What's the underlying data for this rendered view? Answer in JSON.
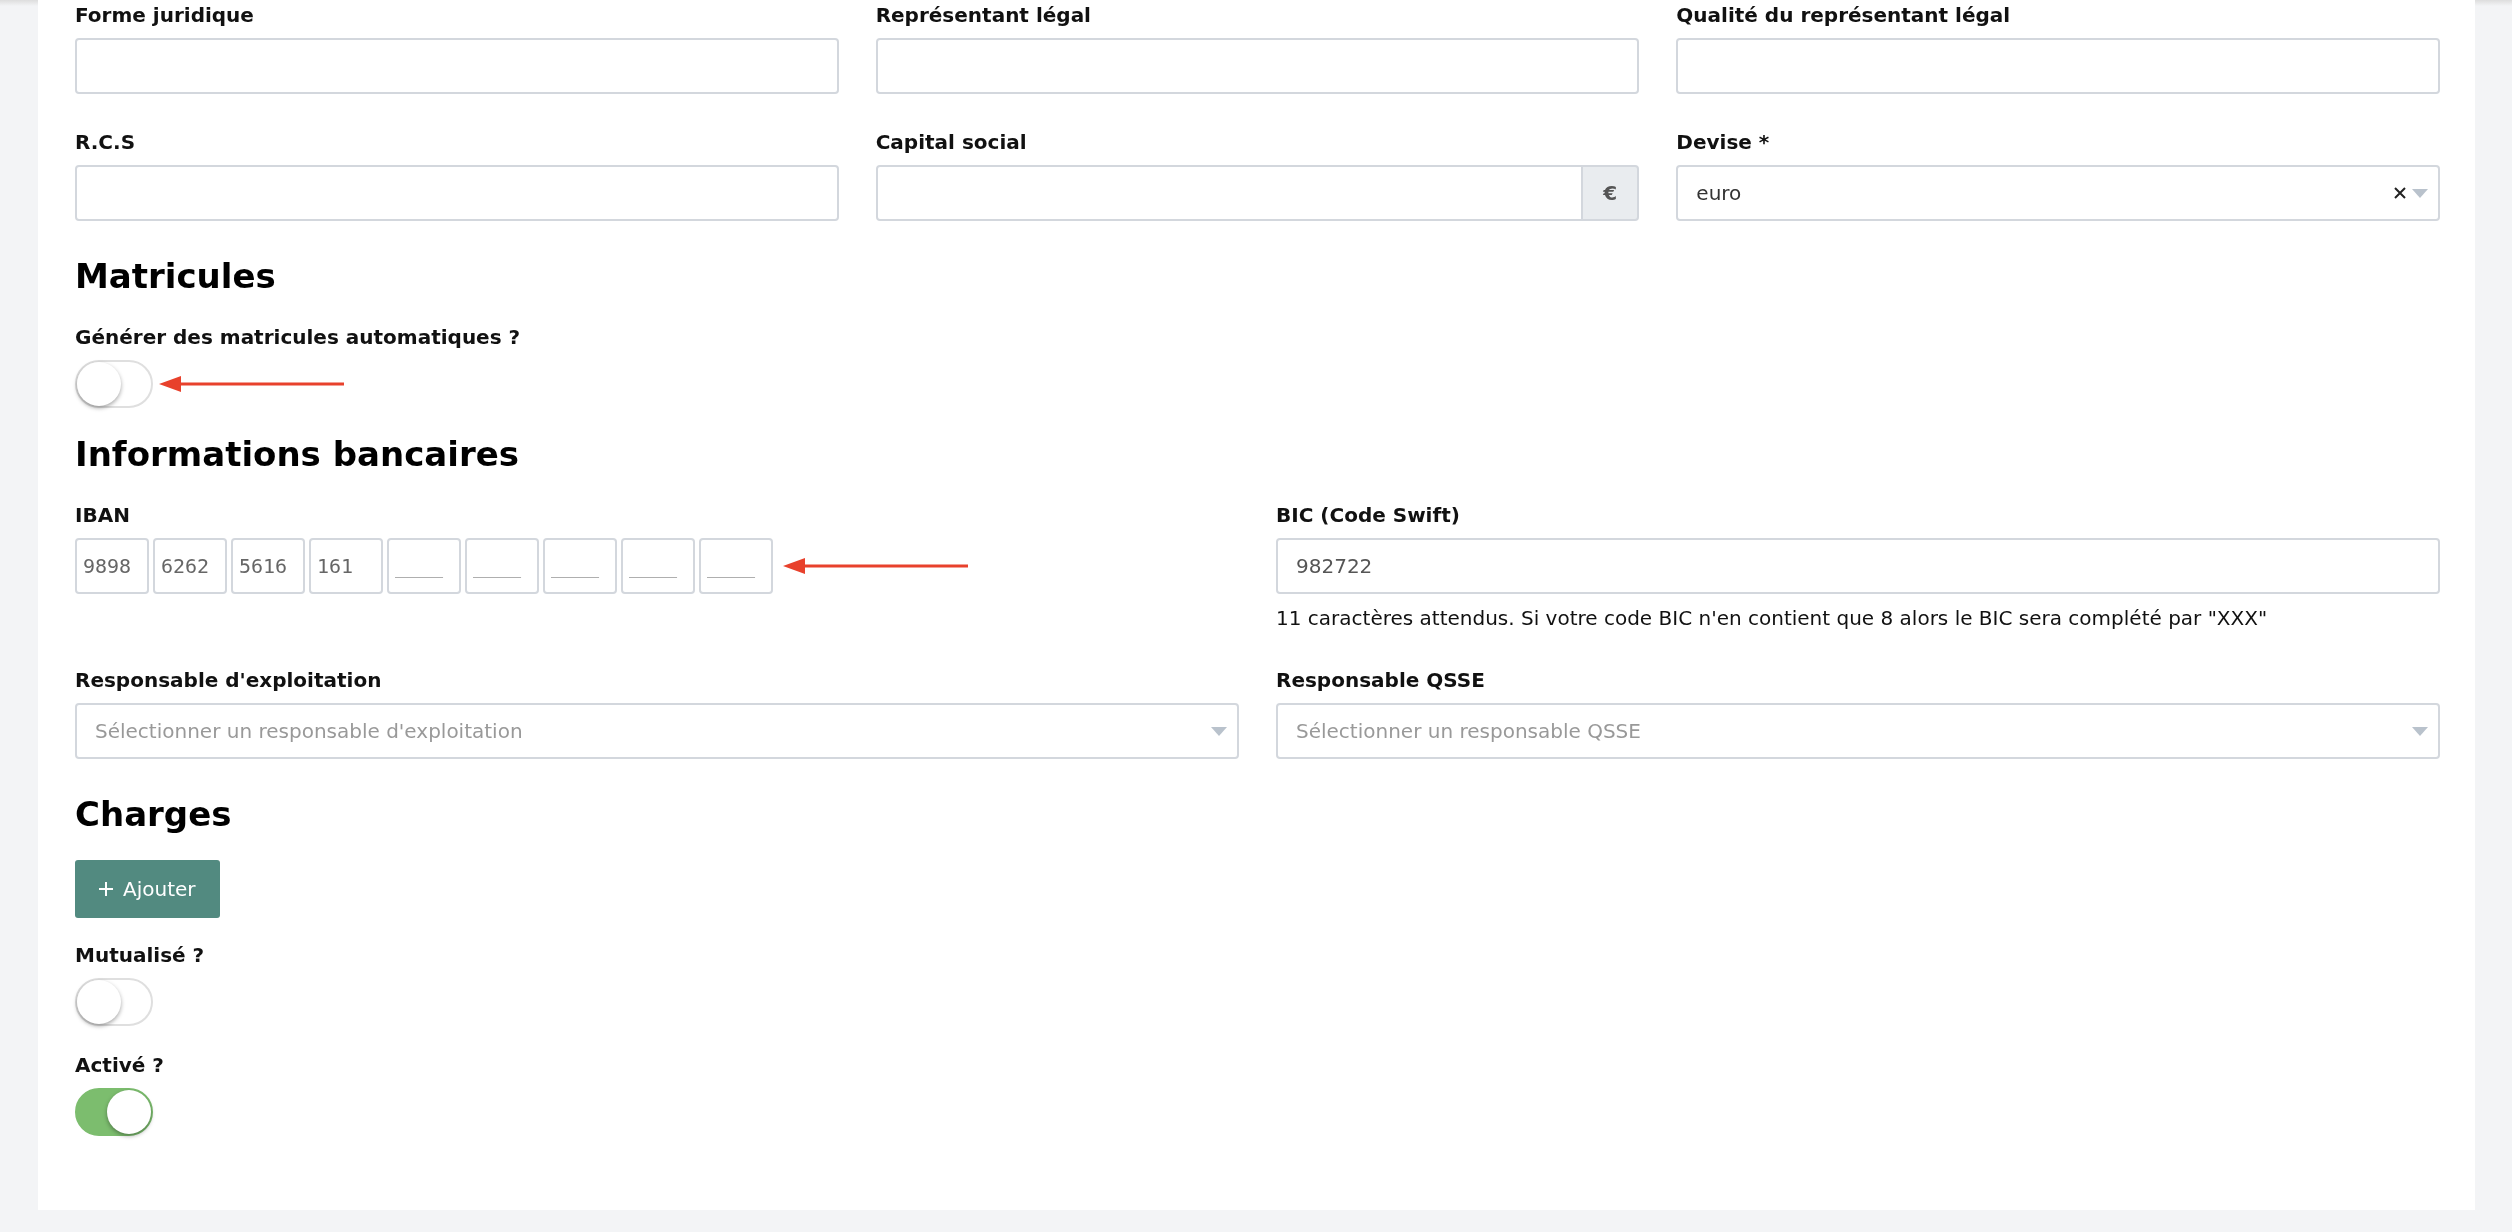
{
  "blocks": [
    {
      "kind": "row",
      "fields": [
        {
          "kind": "text",
          "label": "Forme juridique"
        },
        {
          "kind": "text",
          "label": "Représentant légal"
        },
        {
          "kind": "text",
          "label": "Qualité du représentant légal"
        }
      ]
    },
    {
      "kind": "row",
      "fields": [
        {
          "kind": "text",
          "label": "R.C.S"
        },
        {
          "kind": "addon",
          "label": "Capital social",
          "addon": "€"
        },
        {
          "kind": "select",
          "label": "Devise *",
          "value": "euro",
          "clearable": true
        }
      ]
    },
    {
      "kind": "heading",
      "text": "Matricules"
    },
    {
      "kind": "toggle",
      "label": "Générer des matricules automatiques ?",
      "on": false,
      "annotated": true
    },
    {
      "kind": "heading",
      "text": "Informations bancaires"
    },
    {
      "kind": "row",
      "fields": [
        {
          "kind": "iban",
          "label": "IBAN",
          "annotated": true,
          "groups": [
            {
              "value": "9898"
            },
            {
              "value": "6262"
            },
            {
              "value": "5616"
            },
            {
              "value": "161"
            },
            {
              "placeholder": "____"
            },
            {
              "placeholder": "____"
            },
            {
              "placeholder": "____"
            },
            {
              "placeholder": "____"
            },
            {
              "placeholder": "____"
            }
          ]
        },
        {
          "kind": "text",
          "label": "BIC (Code Swift)",
          "value": "982722",
          "help": "11 caractères attendus. Si votre code BIC n'en contient que 8 alors le BIC sera complété par \"XXX\""
        }
      ]
    },
    {
      "kind": "row",
      "fields": [
        {
          "kind": "select",
          "label": "Responsable d'exploitation",
          "placeholder": "Sélectionner un responsable d'exploitation"
        },
        {
          "kind": "select",
          "label": "Responsable QSSE",
          "placeholder": "Sélectionner un responsable QSSE"
        }
      ]
    },
    {
      "kind": "heading",
      "text": "Charges"
    },
    {
      "kind": "button",
      "label": "Ajouter"
    },
    {
      "kind": "toggle",
      "label": "Mutualisé ?",
      "on": false
    },
    {
      "kind": "toggle",
      "label": "Activé ?",
      "on": true
    }
  ]
}
